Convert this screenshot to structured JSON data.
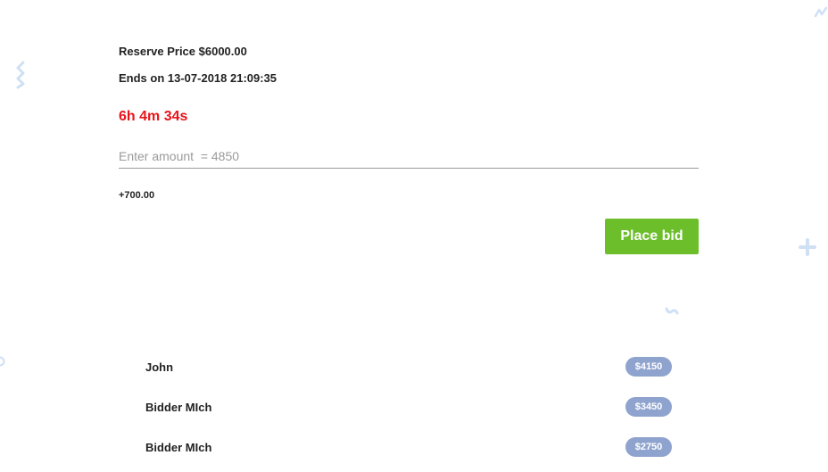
{
  "auction": {
    "reserve_price": "Reserve Price $6000.00",
    "ends_on": "Ends on 13-07-2018 21:09:35",
    "countdown": "6h 4m 34s",
    "amount_placeholder": "Enter amount  = 4850",
    "increment": "+700.00",
    "place_bid_label": "Place bid"
  },
  "bids": [
    {
      "name": "John",
      "amount": "$4150"
    },
    {
      "name": "Bidder MIch",
      "amount": "$3450"
    },
    {
      "name": "Bidder MIch",
      "amount": "$2750"
    }
  ],
  "colors": {
    "countdown": "#e8141a",
    "button": "#6cbf2b",
    "badge": "#8fa3cf",
    "decoration": "#cfe0f5"
  },
  "decorations": [
    "squiggle-icon",
    "squiggle-icon",
    "plus-icon",
    "squiggle-icon",
    "circle-icon"
  ]
}
